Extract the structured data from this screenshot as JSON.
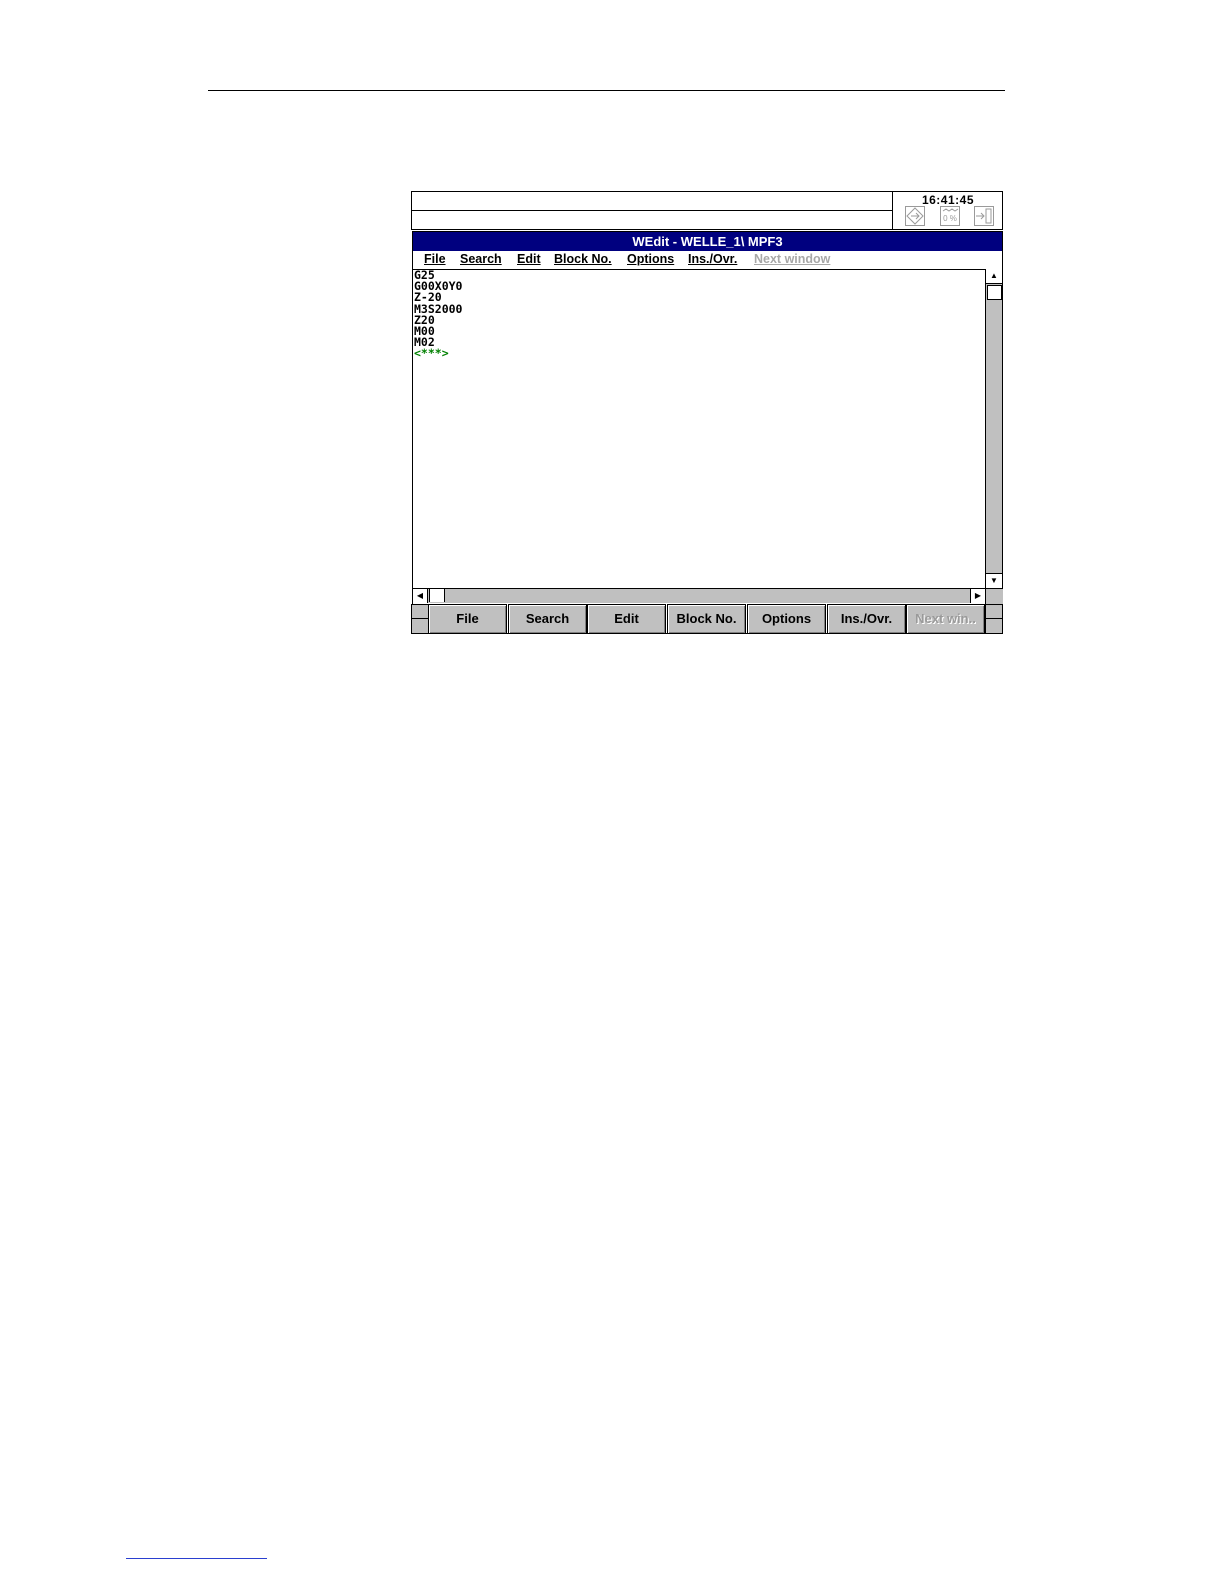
{
  "status": {
    "message_line_1": "",
    "message_line_2": "",
    "clock": "16:41:45",
    "icons": [
      "program-state-icon",
      "feed-override-icon",
      "exit-icon"
    ],
    "override_text": "0 %"
  },
  "window": {
    "title": "WEdit  -  WELLE_1\\ MPF3",
    "menu": [
      {
        "label": "File",
        "enabled": true
      },
      {
        "label": "Search",
        "enabled": true
      },
      {
        "label": "Edit",
        "enabled": true
      },
      {
        "label": "Block No.",
        "enabled": true
      },
      {
        "label": "Options",
        "enabled": true
      },
      {
        "label": "Ins./Ovr.",
        "enabled": true
      },
      {
        "label": "Next window",
        "enabled": false
      }
    ],
    "code_lines": [
      "G25",
      "G00X0Y0",
      "Z-20",
      "M3S2000",
      "Z20",
      "M00",
      "M02"
    ],
    "end_marker": "<***>"
  },
  "softkeys": [
    {
      "label": "File",
      "enabled": true
    },
    {
      "label": "Search",
      "enabled": true
    },
    {
      "label": "Edit",
      "enabled": true
    },
    {
      "label": "Block No.",
      "enabled": true
    },
    {
      "label": "Options",
      "enabled": true
    },
    {
      "label": "Ins./Ovr.",
      "enabled": true
    },
    {
      "label": "Next win..",
      "enabled": false
    }
  ],
  "colors": {
    "title_bar": "#00007f",
    "end_marker": "#008000",
    "softkey_face": "#c0c0c0",
    "disabled_text": "#a8a8a8"
  }
}
